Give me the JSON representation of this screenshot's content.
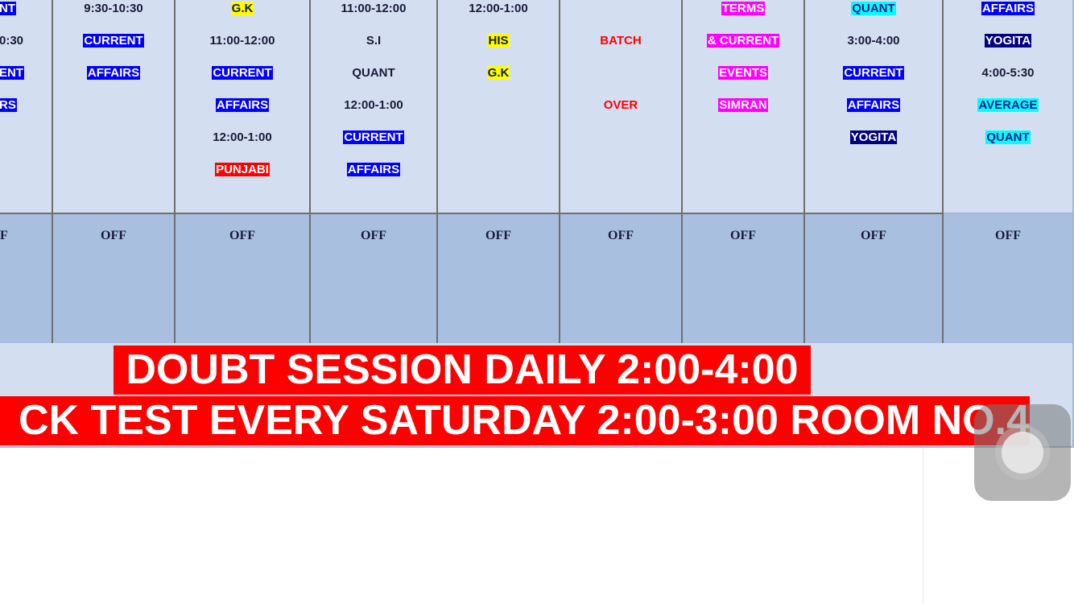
{
  "schedule": {
    "columns": [
      {
        "cells": [
          {
            "text": "NT",
            "style": "hl-blue"
          },
          {
            "text": "0:30",
            "style": "plain"
          },
          {
            "text": "ENT",
            "style": "hl-blue"
          },
          {
            "text": "RS",
            "style": "hl-blue"
          }
        ]
      },
      {
        "cells": [
          {
            "text": "9:30-10:30",
            "style": "plain"
          },
          {
            "text": "CURRENT",
            "style": "hl-blue"
          },
          {
            "text": "AFFAIRS",
            "style": "hl-blue"
          }
        ]
      },
      {
        "cells": [
          {
            "text": "G.K",
            "style": "hl-yellow"
          },
          {
            "text": "11:00-12:00",
            "style": "plain"
          },
          {
            "text": "CURRENT",
            "style": "hl-blue"
          },
          {
            "text": "AFFAIRS",
            "style": "hl-blue"
          },
          {
            "text": "12:00-1:00",
            "style": "plain"
          },
          {
            "text": "PUNJABI",
            "style": "hl-red"
          }
        ]
      },
      {
        "cells": [
          {
            "text": "11:00-12:00",
            "style": "plain"
          },
          {
            "text": "S.I",
            "style": "plain"
          },
          {
            "text": "QUANT",
            "style": "plain"
          },
          {
            "text": "12:00-1:00",
            "style": "plain"
          },
          {
            "text": "CURRENT",
            "style": "hl-blue"
          },
          {
            "text": "AFFAIRS",
            "style": "hl-blue"
          }
        ]
      },
      {
        "cells": [
          {
            "text": "12:00-1:00",
            "style": "plain"
          },
          {
            "text": "HIS",
            "style": "hl-yellow"
          },
          {
            "text": "G.K",
            "style": "hl-yellow"
          }
        ]
      },
      {
        "cells": [
          {
            "text": "",
            "style": "plain"
          },
          {
            "text": "BATCH",
            "style": "txt-red"
          },
          {
            "text": "",
            "style": "plain"
          },
          {
            "text": "OVER",
            "style": "txt-red"
          }
        ]
      },
      {
        "cells": [
          {
            "text": "TERMS",
            "style": "hl-magenta"
          },
          {
            "text": "& CURRENT",
            "style": "hl-magenta"
          },
          {
            "text": "EVENTS",
            "style": "hl-magenta"
          },
          {
            "text": "SIMRAN",
            "style": "hl-magenta"
          }
        ]
      },
      {
        "cells": [
          {
            "text": "QUANT",
            "style": "hl-cyan"
          },
          {
            "text": "3:00-4:00",
            "style": "plain"
          },
          {
            "text": "CURRENT",
            "style": "hl-blue"
          },
          {
            "text": "AFFAIRS",
            "style": "hl-blue"
          },
          {
            "text": "YOGITA",
            "style": "hl-navy"
          }
        ]
      },
      {
        "cells": [
          {
            "text": "AFFAIRS",
            "style": "hl-blue"
          },
          {
            "text": "YOGITA",
            "style": "hl-navy"
          },
          {
            "text": "4:00-5:30",
            "style": "plain"
          },
          {
            "text": "AVERAGE",
            "style": "hl-cyan"
          },
          {
            "text": "QUANT",
            "style": "hl-cyan"
          }
        ]
      }
    ],
    "off_labels": [
      "F",
      "OFF",
      "OFF",
      "OFF",
      "OFF",
      "OFF",
      "OFF",
      "OFF",
      "OFF"
    ]
  },
  "banners": {
    "doubt_session": "DOUBT SESSION DAILY 2:00-4:00",
    "mock_test": "CK TEST EVERY SATURDAY 2:00-3:00 ROOM NO.4"
  },
  "colors": {
    "cell_bg": "#d3dff0",
    "off_bg": "#a8bfdf",
    "banner_red": "#ff0000",
    "highlight_blue": "#0000ff",
    "highlight_navy": "#000080",
    "highlight_yellow": "#ffff00",
    "highlight_magenta": "#ff00ff",
    "highlight_cyan": "#00ffff"
  },
  "overlay": {
    "icon": "assistive-touch-icon"
  }
}
